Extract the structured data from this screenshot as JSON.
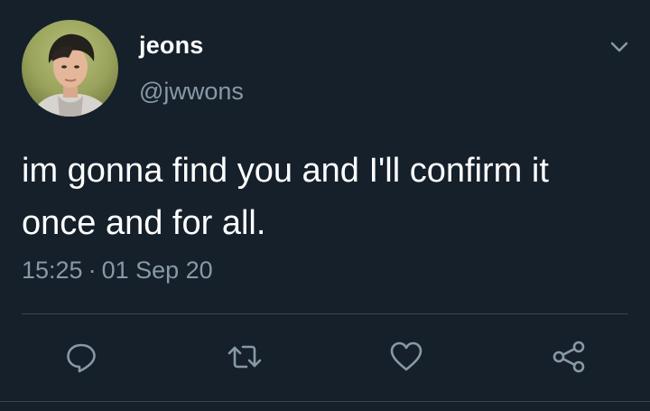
{
  "user": {
    "display_name": "jeons",
    "handle": "@jwwons"
  },
  "tweet": {
    "text": "im gonna find you and I'll confirm it once and for all.",
    "time": "15:25",
    "separator": "·",
    "date": "01 Sep 20"
  },
  "icons": {
    "menu": "chevron-down-icon",
    "reply": "reply-icon",
    "retweet": "retweet-icon",
    "like": "heart-icon",
    "share": "share-icon"
  },
  "colors": {
    "background": "#15202b",
    "text": "#ffffff",
    "secondary_text": "#8899a6",
    "divider": "#38444d"
  }
}
